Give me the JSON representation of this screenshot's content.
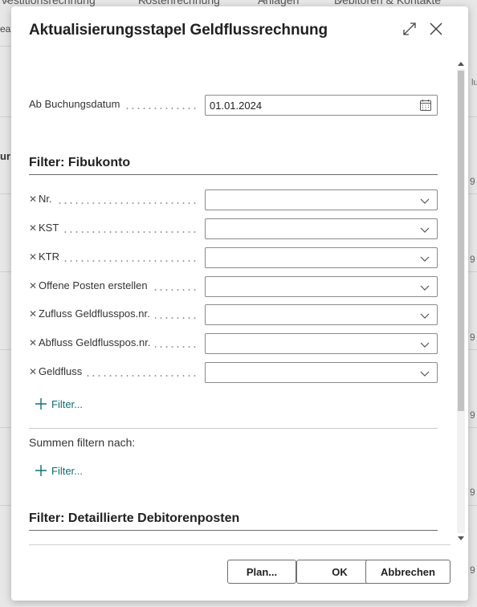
{
  "background": {
    "nav_items": [
      "vestitionsrechnung",
      "Kostenrechnung",
      "Anlagen",
      "Debitoren & Kontakte"
    ],
    "left_fragments": [
      "ea"
    ],
    "left_bold_fragments": [
      "ur"
    ],
    "right_fragments": [
      "lu"
    ],
    "right_digits": [
      "9",
      "9",
      "9",
      "9",
      "9",
      "9"
    ]
  },
  "dialog": {
    "title": "Aktualisierungsstapel Geldflussrechnung",
    "expand_icon": "expand-icon",
    "close_icon": "close-icon"
  },
  "posting_date": {
    "label": "Ab Buchungsdatum",
    "value": "01.01.2024",
    "icon": "calendar-icon"
  },
  "filter_gl": {
    "heading": "Filter: Fibukonto",
    "fields": [
      {
        "label": "Nr.",
        "value": ""
      },
      {
        "label": "KST",
        "value": ""
      },
      {
        "label": "KTR",
        "value": ""
      },
      {
        "label": "Offene Posten erstellen",
        "value": ""
      },
      {
        "label": "Zufluss Geldflusspos.nr.",
        "value": ""
      },
      {
        "label": "Abfluss Geldflusspos.nr.",
        "value": ""
      },
      {
        "label": "Geldfluss",
        "value": ""
      }
    ],
    "add_filter": "Filter..."
  },
  "totals_filter": {
    "label": "Summen filtern nach:",
    "add_filter": "Filter..."
  },
  "filter_customer": {
    "heading": "Filter: Detaillierte Debitorenposten"
  },
  "buttons": {
    "plan": "Plan...",
    "ok": "OK",
    "cancel": "Abbrechen"
  }
}
